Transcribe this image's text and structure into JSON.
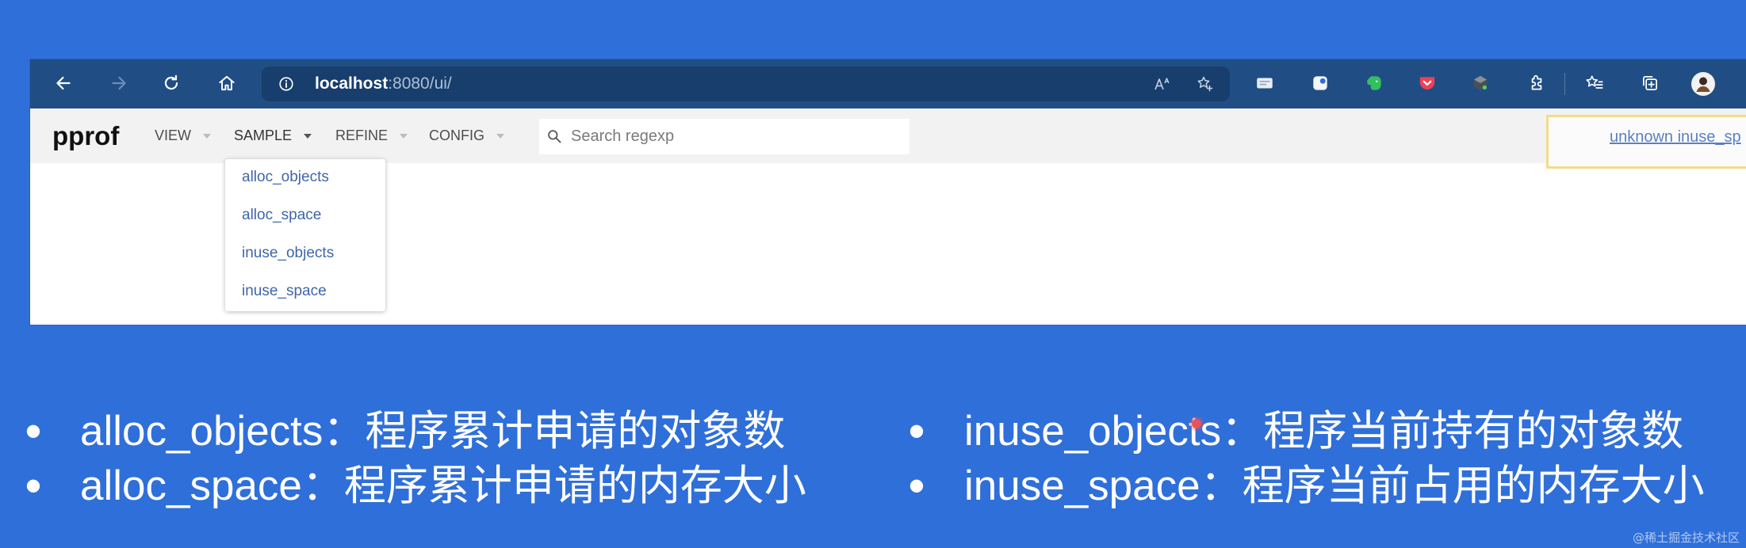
{
  "browser": {
    "nav_icons": [
      "back-arrow-icon",
      "forward-arrow-icon",
      "refresh-icon",
      "home-icon"
    ],
    "address_bar": {
      "host": "localhost",
      "path": ":8080/ui/",
      "left_icon": "info-icon",
      "right_icons": [
        "read-aloud-icon",
        "add-favorite-icon"
      ]
    },
    "extension_icons": [
      "extension-card-icon",
      "extension-shield-icon",
      "evernote-icon",
      "pocket-icon",
      "extension-cube-icon",
      "extensions-puzzle-icon"
    ],
    "toolbar_icons": [
      "favorites-icon",
      "collections-icon",
      "profile-avatar"
    ]
  },
  "pprof": {
    "title": "pprof",
    "menu_caret_icon": "caret-down-icon",
    "menus": [
      {
        "label": "VIEW"
      },
      {
        "label": "SAMPLE",
        "open": true
      },
      {
        "label": "REFINE"
      },
      {
        "label": "CONFIG"
      }
    ],
    "search": {
      "placeholder": "Search regexp",
      "value": "",
      "icon": "search-icon"
    },
    "legend_link": "unknown inuse_sp",
    "sample_menu": {
      "items": [
        "alloc_objects",
        "alloc_space",
        "inuse_objects",
        "inuse_space"
      ]
    }
  },
  "slide": {
    "bullet": "•",
    "left_column": [
      "alloc_objects：程序累计申请的对象数",
      "alloc_space：程序累计申请的内存大小"
    ],
    "right_column": [
      "inuse_objects：程序当前持有的对象数",
      "inuse_space：程序当前占用的内存大小"
    ]
  },
  "watermark": "@稀土掘金技术社区",
  "colors": {
    "slide_background": "#2f6fda",
    "browser_toolbar": "#204e84",
    "address_bar": "#173e6c",
    "menu_link": "#3f66a9",
    "legend_border": "#f2dc88"
  }
}
